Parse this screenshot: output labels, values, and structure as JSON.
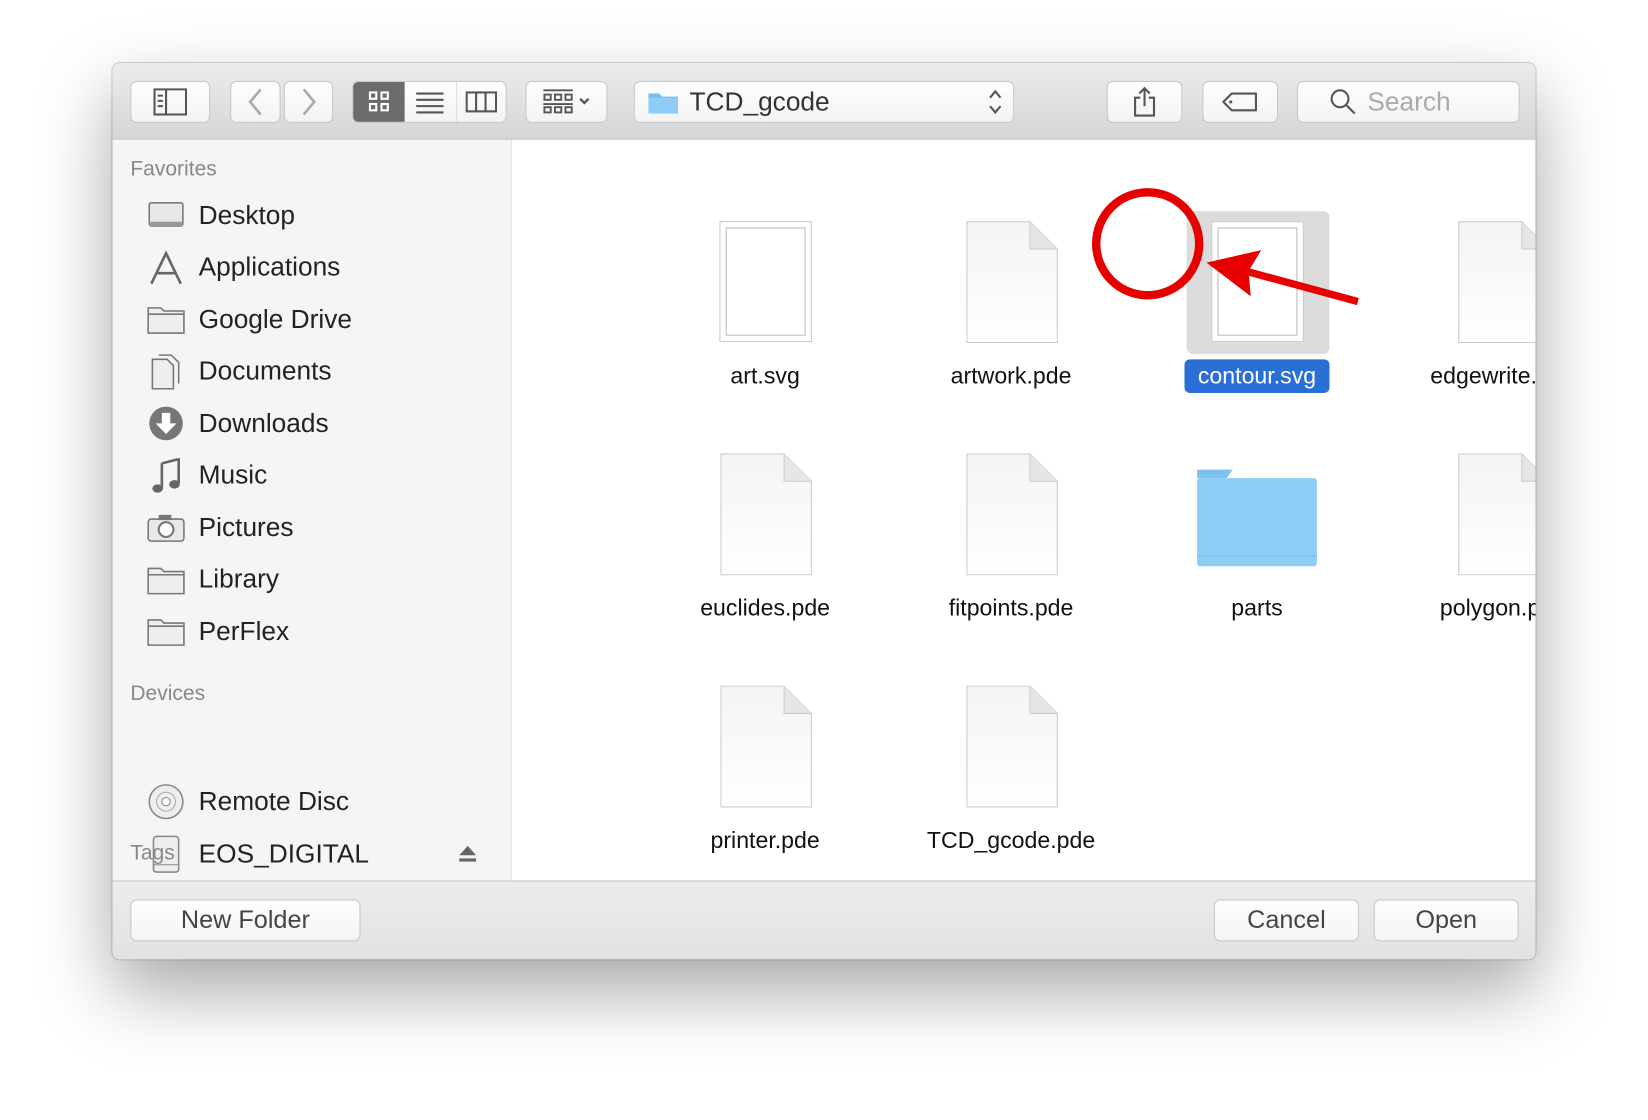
{
  "toolbar": {
    "path_folder": "TCD_gcode",
    "search_placeholder": "Search",
    "view_modes": [
      "icon",
      "list",
      "column"
    ],
    "selected_view": "icon"
  },
  "sidebar": {
    "favorites_header": "Favorites",
    "favorites": [
      {
        "label": "Desktop",
        "icon": "desktop-icon"
      },
      {
        "label": "Applications",
        "icon": "applications-icon"
      },
      {
        "label": "Google Drive",
        "icon": "folder-icon"
      },
      {
        "label": "Documents",
        "icon": "documents-icon"
      },
      {
        "label": "Downloads",
        "icon": "downloads-icon"
      },
      {
        "label": "Music",
        "icon": "music-icon"
      },
      {
        "label": "Pictures",
        "icon": "camera-icon"
      },
      {
        "label": "Library",
        "icon": "folder-icon"
      },
      {
        "label": "PerFlex",
        "icon": "folder-icon"
      }
    ],
    "devices_header": "Devices",
    "devices": [
      {
        "label": "Remote Disc",
        "icon": "disc-icon"
      },
      {
        "label": "EOS_DIGITAL",
        "icon": "drive-icon",
        "ejectable": true
      }
    ],
    "tags_header": "Tags"
  },
  "files": [
    {
      "name": "art.svg",
      "type": "svg"
    },
    {
      "name": "artwork.pde",
      "type": "doc"
    },
    {
      "name": "contour.svg",
      "type": "svg",
      "selected": true
    },
    {
      "name": "edgewrite.pde",
      "type": "doc"
    },
    {
      "name": "euclides.pde",
      "type": "doc"
    },
    {
      "name": "fitpoints.pde",
      "type": "doc"
    },
    {
      "name": "parts",
      "type": "folder"
    },
    {
      "name": "polygon.pde",
      "type": "doc"
    },
    {
      "name": "printer.pde",
      "type": "doc"
    },
    {
      "name": "TCD_gcode.pde",
      "type": "doc"
    }
  ],
  "footer": {
    "new_folder": "New Folder",
    "cancel": "Cancel",
    "open": "Open"
  },
  "colors": {
    "selection": "#2a6fd6",
    "annotation": "#e60000",
    "folder": "#8dcdf5"
  }
}
